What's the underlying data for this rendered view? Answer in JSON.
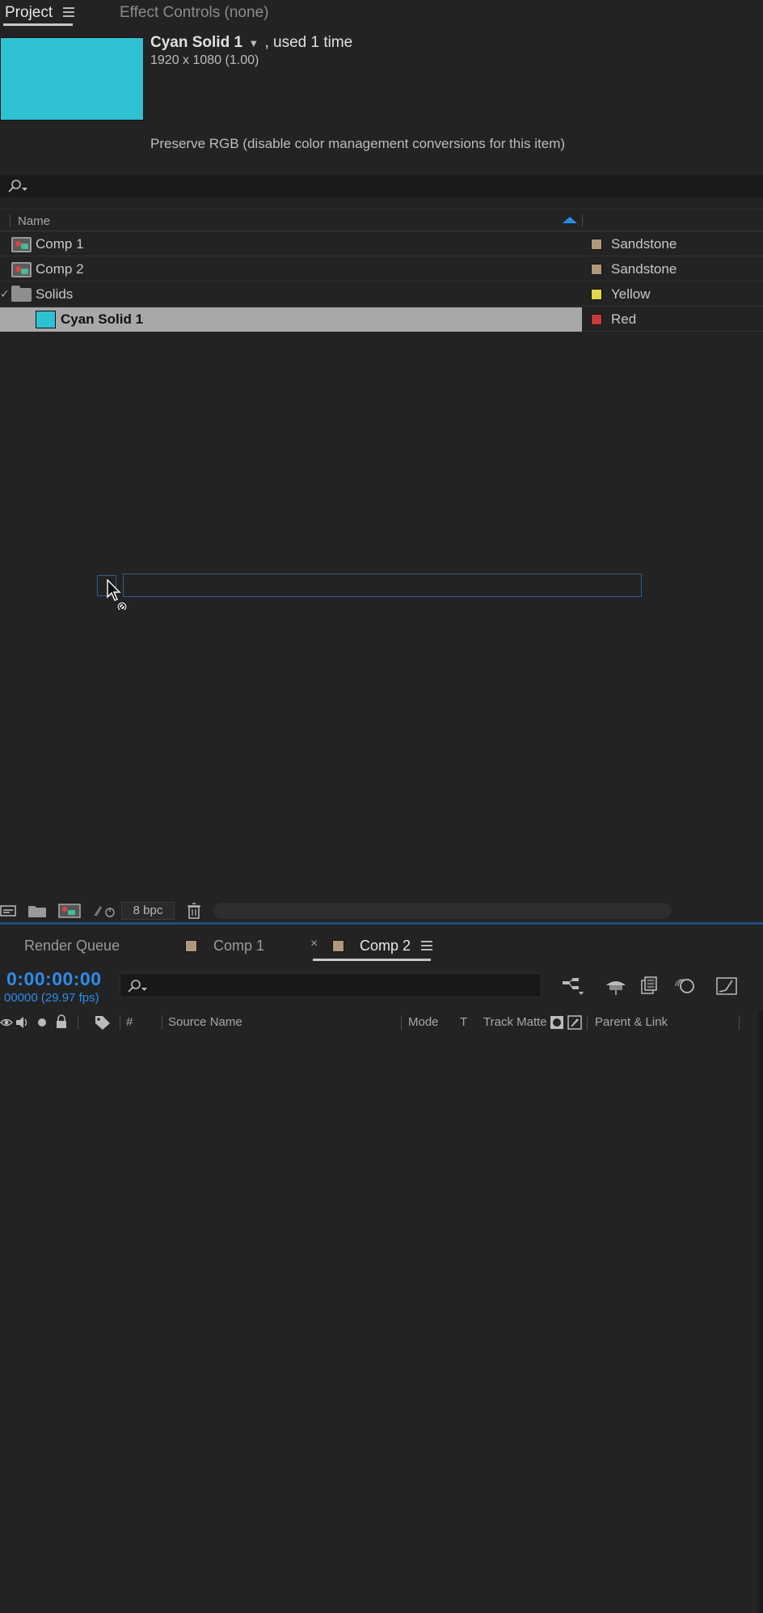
{
  "project_panel": {
    "tabs": [
      {
        "label": "Project",
        "active": true
      },
      {
        "label": "Effect Controls (none)",
        "active": false
      }
    ],
    "item_info": {
      "name": "Cyan Solid 1",
      "usage": ", used 1 time",
      "dimensions": "1920 x 1080 (1.00)",
      "preserve_rgb": "Preserve RGB (disable color management conversions for this item)",
      "thumbnail_color": "#2ec1d2"
    },
    "columns": {
      "name": "Name"
    },
    "items": [
      {
        "name": "Comp 1",
        "type": "composition",
        "label": "Sandstone",
        "label_color": "#b0987a"
      },
      {
        "name": "Comp 2",
        "type": "composition",
        "label": "Sandstone",
        "label_color": "#b0987a"
      },
      {
        "name": "Solids",
        "type": "folder",
        "label": "Yellow",
        "label_color": "#e3d54a"
      },
      {
        "name": "Cyan Solid 1",
        "type": "solid",
        "label": "Red",
        "label_color": "#c83a3a",
        "selected": true
      }
    ],
    "footer": {
      "bit_depth": "8 bpc"
    }
  },
  "timeline_panel": {
    "tabs": [
      {
        "label": "Render Queue",
        "active": false
      },
      {
        "label": "Comp 1",
        "active": false
      },
      {
        "label": "Comp 2",
        "active": true
      }
    ],
    "timecode": "0:00:00:00",
    "frame_fps": "00000 (29.97 fps)",
    "columns": {
      "number": "#",
      "source_name": "Source Name",
      "mode": "Mode",
      "t": "T",
      "track_matte": "Track Matte",
      "parent_link": "Parent & Link"
    }
  },
  "colors": {
    "accent_blue": "#2d8ceb",
    "panel_bg": "#232323",
    "selection": "#a8a8a8"
  }
}
